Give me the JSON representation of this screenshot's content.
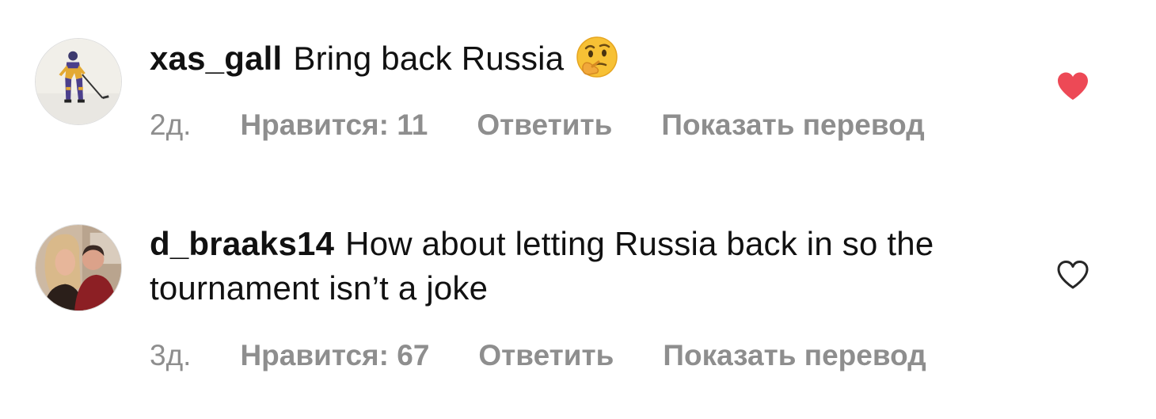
{
  "comments": [
    {
      "username": "xas_gall",
      "text": "Bring back Russia",
      "emoji": "thinking-face-emoji",
      "time": "2д.",
      "likes": "Нравится: 11",
      "reply": "Ответить",
      "translate": "Показать перевод",
      "liked": true,
      "heart_color": "#ed4956"
    },
    {
      "username": "d_braaks14",
      "text": "How about letting Russia back in so the tournament isn’t a joke",
      "time": "3д.",
      "likes": "Нравится: 67",
      "reply": "Ответить",
      "translate": "Показать перевод",
      "liked": false,
      "heart_color": "#262626"
    }
  ],
  "colors": {
    "text": "#111111",
    "meta": "#8e8e8e",
    "like_active": "#ed4956"
  }
}
